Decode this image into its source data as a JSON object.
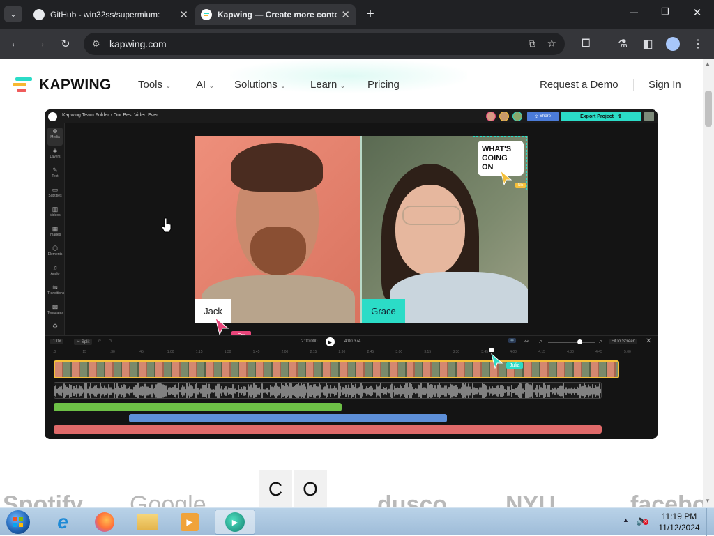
{
  "browser": {
    "tabs": [
      {
        "title": "GitHub - win32ss/supermium:",
        "active": false
      },
      {
        "title": "Kapwing — Create more content",
        "active": true
      }
    ],
    "new_tab": "+",
    "url": "kapwing.com",
    "window_controls": {
      "minimize": "—",
      "maximize": "❐",
      "close": "✕"
    }
  },
  "site": {
    "brand": "KAPWING",
    "nav": [
      {
        "label": "Tools"
      },
      {
        "label": "AI"
      },
      {
        "label": "Solutions"
      },
      {
        "label": "Learn"
      },
      {
        "label": "Pricing"
      }
    ],
    "request_demo": "Request a Demo",
    "sign_in": "Sign In",
    "partial_letters": [
      "C",
      "O"
    ],
    "logos": [
      "Spotify",
      "Google",
      "dusco",
      "NYU",
      "facebook"
    ]
  },
  "editor": {
    "breadcrumb": "Kapwing Team Folder › Our Best Video Ever",
    "share": "Share",
    "export": "Export Project",
    "sidebar": [
      "Media",
      "Layers",
      "Text",
      "Subtitles",
      "Videos",
      "Images",
      "Elements",
      "Audio",
      "Transitions",
      "Templates"
    ],
    "sticker_text": [
      "WHAT'S",
      "GOING",
      "ON"
    ],
    "name_left": "Jack",
    "name_right": "Grace",
    "cursor_em": "Em",
    "cursor_julia": "Julia",
    "cursor_sticker": "Nik",
    "timeline": {
      "speed": "1.0x",
      "split": "Split",
      "current_time": "2:00.000",
      "total_time": "4:00.374",
      "fit": "Fit to Screen",
      "ticks": [
        ":0",
        ":15",
        ":30",
        ":45",
        "1:00",
        "1:15",
        "1:30",
        "1:45",
        "2:00",
        "2:15",
        "2:30",
        "2:45",
        "3:00",
        "3:15",
        "3:30",
        "3:45",
        "4:00",
        "4:15",
        "4:30",
        "4:45",
        "5:00"
      ]
    }
  },
  "taskbar": {
    "time": "11:19 PM",
    "date": "11/12/2024"
  },
  "colors": {
    "kapwing_teal": "#2bdcc7",
    "share_blue": "#4b7bd8",
    "em_pink": "#e8457a",
    "track_green": "#6dc046",
    "track_blue": "#5d8fd8",
    "track_red": "#e06a6a",
    "sticker_yellow": "#f5c03a"
  }
}
